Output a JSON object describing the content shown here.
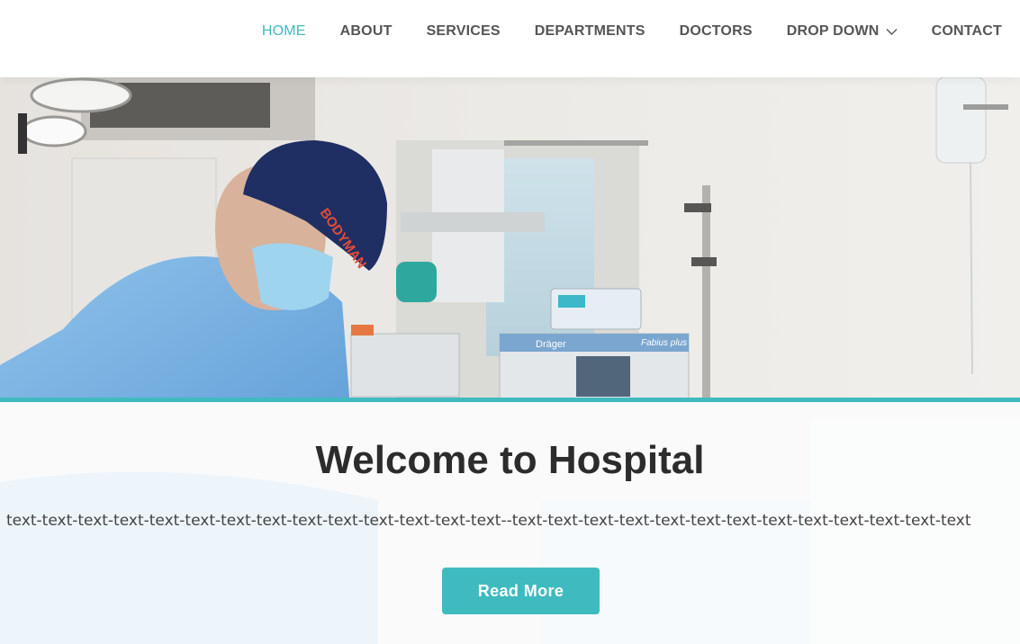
{
  "nav": {
    "items": [
      {
        "label": "HOME",
        "active": true
      },
      {
        "label": "ABOUT"
      },
      {
        "label": "SERVICES"
      },
      {
        "label": "DEPARTMENTS"
      },
      {
        "label": "DOCTORS"
      },
      {
        "label": "DROP DOWN",
        "has_dropdown": true
      },
      {
        "label": "CONTACT"
      }
    ]
  },
  "hero": {
    "title": "Welcome to Hospital",
    "subtext": "text-text-text-text-text-text-text-text-text-text-text-text-text-text--text-text-text-text-text-text-text-text-text-text-text-text-text",
    "button_label": "Read More",
    "cap_text": "BODYMAN",
    "monitor_brand": "Dräger",
    "monitor_model": "Fabius plus"
  },
  "colors": {
    "accent": "#3fbbc0",
    "nav_text": "#555555",
    "title": "#2c2c2c"
  }
}
